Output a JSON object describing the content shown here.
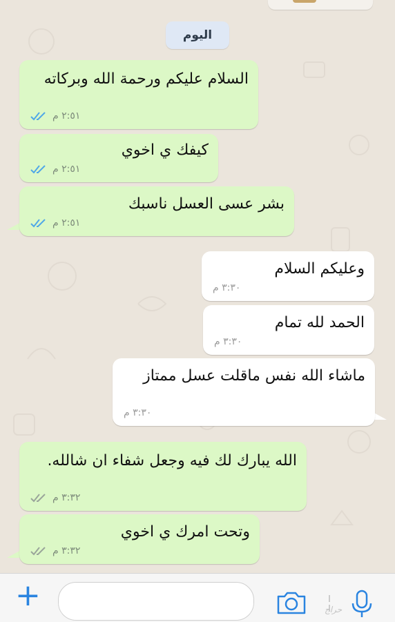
{
  "date_separator": "اليوم",
  "messages": [
    {
      "text": "السلام عليكم ورحمة الله وبركاته",
      "time": "٢:٥١ م",
      "direction": "outgoing",
      "status": "read"
    },
    {
      "text": "كيفك ي اخوي",
      "time": "٢:٥١ م",
      "direction": "outgoing",
      "status": "read"
    },
    {
      "text": "بشر عسى العسل ناسبك",
      "time": "٢:٥١ م",
      "direction": "outgoing",
      "status": "read"
    },
    {
      "text": "وعليكم السلام",
      "time": "٣:٣٠ م",
      "direction": "incoming"
    },
    {
      "text": "الحمد لله تمام",
      "time": "٣:٣٠ م",
      "direction": "incoming"
    },
    {
      "text": "ماشاء الله نفس ماقلت عسل ممتاز",
      "time": "٣:٣٠ م",
      "direction": "incoming"
    },
    {
      "text": "الله يبارك لك فيه وجعل شفاء ان شالله.",
      "time": "٣:٣٢ م",
      "direction": "outgoing",
      "status": "delivered"
    },
    {
      "text": "وتحت امرك ي اخوي",
      "time": "٣:٣٢ م",
      "direction": "outgoing",
      "status": "delivered"
    }
  ],
  "composer": {
    "placeholder": "",
    "watermark": "حراج"
  },
  "colors": {
    "outgoing_bubble": "#dcf8c6",
    "incoming_bubble": "#ffffff",
    "read_tick": "#4fa7e8",
    "delivered_tick": "#9aa59a",
    "accent": "#2a84e0"
  },
  "icons": [
    "plus-icon",
    "camera-icon",
    "microphone-icon"
  ]
}
